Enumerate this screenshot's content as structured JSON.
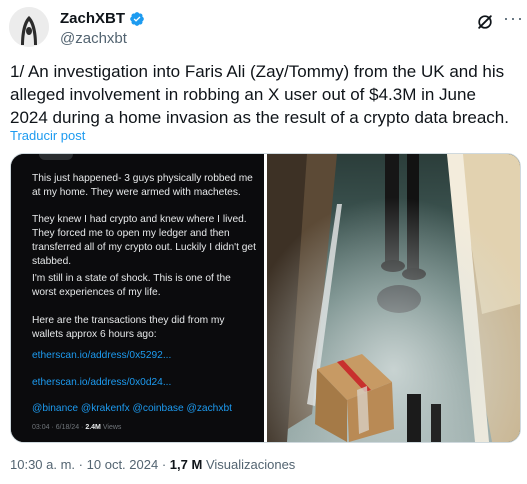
{
  "author": {
    "name": "ZachXBT",
    "handle": "@zachxbt",
    "verified_color": "#1d9bf0"
  },
  "icons": [
    "avatar",
    "verified-badge-icon",
    "grok-icon",
    "more-options-icon"
  ],
  "tweet": {
    "text": "1/ An investigation into Faris Ali (Zay/Tommy) from the UK and his alleged involvement in robbing an X user out of $4.3M in June 2024 during a home invasion as the result of a crypto data breach.",
    "translate_label": "Traducir post"
  },
  "embedded_post": {
    "paragraphs": [
      "This just happened- 3 guys physically robbed me at my home. They were armed with machetes.",
      "They knew I had crypto and knew where I lived. They forced me to open my ledger and then transferred all of my crypto out. Luckily I didn't get stabbed.",
      "I'm still in a state of shock. This is one of the worst experiences of my life.",
      "Here are the transactions they did from my wallets approx 6 hours ago:"
    ],
    "links": [
      "etherscan.io/address/0x5292...",
      "etherscan.io/address/0x0d24..."
    ],
    "mentions": "@binance @krakenfx @coinbase @zachxbt",
    "timestamp": "03:04 · 6/18/24 ·",
    "views": "2.4M",
    "views_label": "Views"
  },
  "footer": {
    "time": "10:30 a. m.",
    "separator": "·",
    "date": "10 oct. 2024",
    "views": "1,7 M",
    "views_label": "Visualizaciones"
  }
}
